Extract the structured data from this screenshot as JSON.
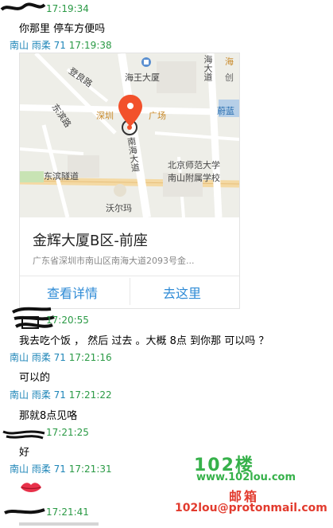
{
  "chat": {
    "messages": [
      {
        "sender": "",
        "time": "17:19:34",
        "text": "你那里 停车方便吗"
      },
      {
        "sender": "南山 雨柔 71",
        "time": "17:19:38",
        "text": ""
      },
      {
        "sender": "",
        "time": "17:20:55",
        "text": "我去吃个饭 ， 然后 过去 。大概 8点 到你那 可以吗 ？"
      },
      {
        "sender": "南山 雨柔 71",
        "time": "17:21:16",
        "text": "可以的"
      },
      {
        "sender": "南山 雨柔 71",
        "time": "17:21:22",
        "text": "那就8点见咯"
      },
      {
        "sender": "",
        "time": "17:21:25",
        "text": "好"
      },
      {
        "sender": "南山 雨柔 71",
        "time": "17:21:31",
        "text": ""
      },
      {
        "sender": "",
        "time": "17:21:41",
        "text": ""
      }
    ],
    "lips_emoji": "lips-icon"
  },
  "location_card": {
    "title": "金辉大厦B区-前座",
    "address": "广东省深圳市南山区南海大道2093号金...",
    "view_details_label": "查看详情",
    "navigate_label": "去这里",
    "map_labels": {
      "hainan_plaza": "海王大厦",
      "shenzhen_plaza": "深圳",
      "shenzhen_plaza_end": "广场",
      "nanhai_road": "南海大道",
      "nanhai_road_right": "海大道",
      "dongbin_tunnel": "东滨隧道",
      "walmart": "沃尔玛",
      "beijing_normal": "北京师范大学",
      "affiliated_school": "南山附属学校",
      "dengliang": "登良路",
      "weilan": "蔚蓝",
      "tai": "大",
      "left_road": "东滨路",
      "right_top": "海",
      "chuang": "创"
    },
    "colors": {
      "pin": "#f2512b",
      "button": "#2f8bd6"
    }
  },
  "watermark": {
    "big": "102楼",
    "url": "www.102lou.com",
    "cn": "邮箱",
    "email": "102lou@protonmail.com"
  }
}
